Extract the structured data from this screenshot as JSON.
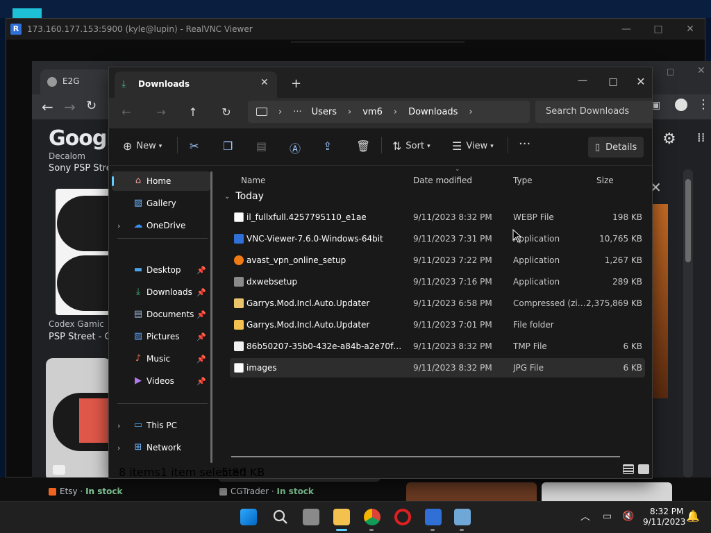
{
  "vnc": {
    "title": "173.160.177.153:5900 (kyle@lupin) - RealVNC Viewer",
    "logo": "R"
  },
  "chrome": {
    "tab_label": "E2G",
    "google_logo": "Google",
    "results": {
      "decal_source": "Decalom",
      "sony_title": "Sony PSP Stre",
      "codex_source": "Codex Gamic",
      "psp_street": "PSP Street - C",
      "etsy_source": "Etsy",
      "etsy_stock": "In stock",
      "cg_source": "CGTrader",
      "cg_stock": "In stock",
      "separator": " · "
    }
  },
  "explorer": {
    "tab_title": "Downloads",
    "new_tab": "+",
    "window_controls": {
      "minimize": "—",
      "maximize": "□",
      "close": "✕"
    },
    "address": [
      "Users",
      "vm6",
      "Downloads"
    ],
    "address_dots": "···",
    "search_placeholder": "Search Downloads",
    "commands": {
      "new": "New",
      "sort": "Sort",
      "view": "View",
      "more": "···",
      "details": "Details"
    },
    "sidebar": {
      "home": "Home",
      "gallery": "Gallery",
      "onedrive": "OneDrive",
      "desktop": "Desktop",
      "downloads": "Downloads",
      "documents": "Documents",
      "pictures": "Pictures",
      "music": "Music",
      "videos": "Videos",
      "thispc": "This PC",
      "network": "Network"
    },
    "columns": {
      "name": "Name",
      "date": "Date modified",
      "type": "Type",
      "size": "Size"
    },
    "group_label": "Today",
    "files": [
      {
        "name": "il_fullxfull.4257795110_e1ae",
        "date": "9/11/2023 8:32 PM",
        "type": "WEBP File",
        "size": "198 KB",
        "icon": "image-file-icon"
      },
      {
        "name": "VNC-Viewer-7.6.0-Windows-64bit",
        "date": "9/11/2023 7:31 PM",
        "type": "Application",
        "size": "10,765 KB",
        "icon": "vnc-app-icon"
      },
      {
        "name": "avast_vpn_online_setup",
        "date": "9/11/2023 7:22 PM",
        "type": "Application",
        "size": "1,267 KB",
        "icon": "avast-app-icon"
      },
      {
        "name": "dxwebsetup",
        "date": "9/11/2023 7:16 PM",
        "type": "Application",
        "size": "289 KB",
        "icon": "setup-app-icon"
      },
      {
        "name": "Garrys.Mod.Incl.Auto.Updater",
        "date": "9/11/2023 6:58 PM",
        "type": "Compressed (zipp...",
        "size": "2,375,869 KB",
        "icon": "zip-folder-icon"
      },
      {
        "name": "Garrys.Mod.Incl.Auto.Updater",
        "date": "9/11/2023 7:01 PM",
        "type": "File folder",
        "size": "",
        "icon": "folder-icon"
      },
      {
        "name": "86b50207-35b0-432e-a84b-a2e70f052819....",
        "date": "9/11/2023 8:32 PM",
        "type": "TMP File",
        "size": "6 KB",
        "icon": "tmp-file-icon"
      },
      {
        "name": "images",
        "date": "9/11/2023 8:32 PM",
        "type": "JPG File",
        "size": "6 KB",
        "icon": "jpg-file-icon"
      }
    ],
    "status": {
      "count": "8 items",
      "selected": "1 item selected",
      "size": "5.80 KB"
    }
  },
  "taskbar": {
    "time": "8:32 PM",
    "date": "9/11/2023"
  },
  "colors": {
    "accent": "#60cdff",
    "explorer_bg": "#191919",
    "taskbar_bg": "#202020"
  }
}
